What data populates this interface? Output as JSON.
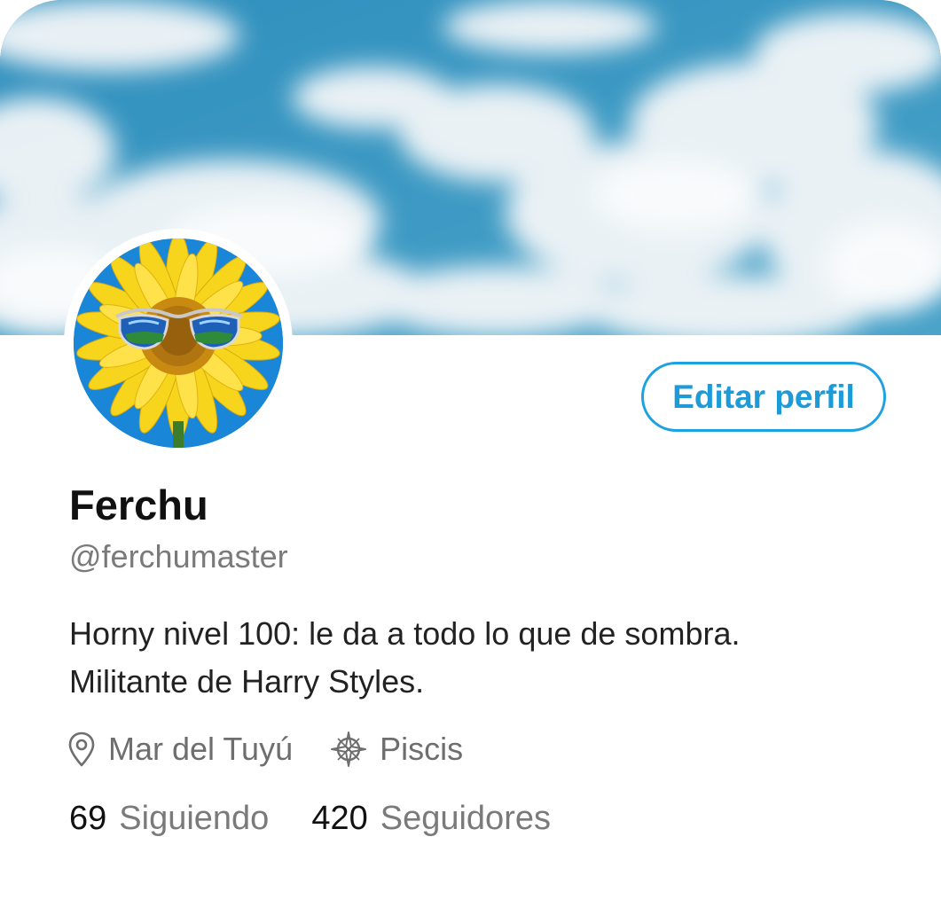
{
  "profile": {
    "display_name": "Ferchu",
    "handle": "@ferchumaster",
    "bio_lines": [
      "Horny nivel 100: le da a todo lo que de sombra.",
      "Militante de Harry Styles."
    ],
    "location": "Mar del Tuyú",
    "sign": "Piscis",
    "following_count": "69",
    "following_label": "Siguiendo",
    "followers_count": "420",
    "followers_label": "Seguidores"
  },
  "actions": {
    "edit_profile_label": "Editar perfil"
  },
  "icons": {
    "location": "map-pin-icon",
    "sign": "compass-icon"
  },
  "colors": {
    "accent": "#1da1e2",
    "muted_text": "#7a7a7a",
    "primary_text": "#111111",
    "banner_sky": "#3c97c0"
  }
}
